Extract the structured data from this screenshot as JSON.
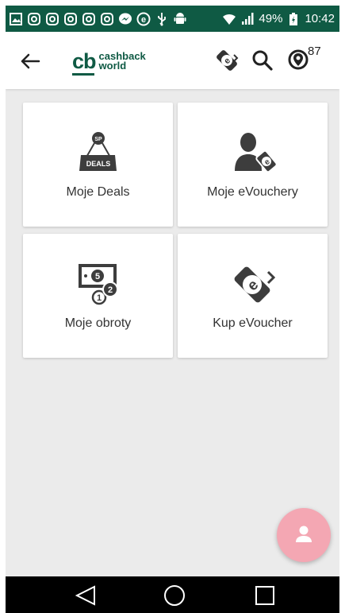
{
  "status_bar": {
    "battery": "49%",
    "time": "10:42",
    "left_icons": [
      "image-icon",
      "instagram-icon",
      "instagram-icon",
      "instagram-icon",
      "instagram-icon",
      "instagram-icon",
      "messenger-icon",
      "e-icon",
      "usb-icon",
      "android-icon"
    ],
    "right_icons": [
      "wifi-icon",
      "signal-icon",
      "battery-icon"
    ]
  },
  "app_bar": {
    "logo_mark": "cb",
    "logo_line1": "cashback",
    "logo_line2": "world",
    "location_count": "87"
  },
  "cards": [
    {
      "label": "Moje Deals",
      "icon": "deals-tag-icon"
    },
    {
      "label": "Moje eVouchery",
      "icon": "user-evoucher-icon"
    },
    {
      "label": "Moje obroty",
      "icon": "money-turnover-icon"
    },
    {
      "label": "Kup eVoucher",
      "icon": "evoucher-phone-icon"
    }
  ],
  "deals_icon_text": {
    "tag": "SP",
    "sign": "DEALS"
  },
  "colors": {
    "brand": "#0f5a44",
    "fab": "#f4a7b3",
    "icon": "#3d3d3d"
  }
}
